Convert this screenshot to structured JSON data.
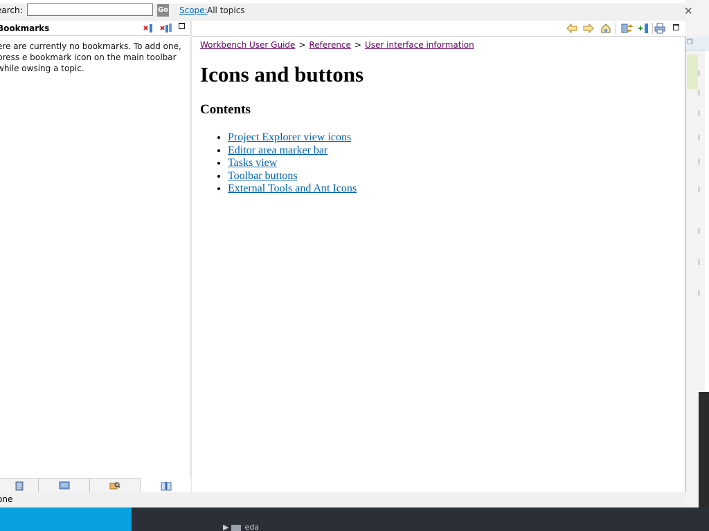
{
  "search": {
    "label": "earch:",
    "value": "",
    "go_label": "Go",
    "scope_label": "Scope:",
    "scope_value": "All topics"
  },
  "bookmarks": {
    "title": "Bookmarks",
    "message": "ere are currently no bookmarks. To add one, press e bookmark icon on the main toolbar while owsing a topic."
  },
  "status": {
    "text": "one"
  },
  "breadcrumb": {
    "items": [
      "Workbench User Guide",
      "Reference",
      "User interface information"
    ],
    "separator": ">"
  },
  "page": {
    "title": "Icons and buttons",
    "contents_heading": "Contents",
    "toc": [
      "Project Explorer view icons",
      "Editor area marker bar",
      "Tasks view",
      "Toolbar buttons",
      "External Tools and Ant Icons"
    ]
  },
  "taskbar": {
    "label": "eda"
  },
  "colors": {
    "link": "#0060b0",
    "visited_link": "#660066",
    "panel_bg": "#f0f0f0",
    "taskbar_accent": "#0aa1e0"
  },
  "icons": {
    "toolbar": [
      "back-icon",
      "forward-icon",
      "home-icon",
      "sync-toc-icon",
      "bookmark-add-icon",
      "print-icon",
      "maximize-icon"
    ],
    "nav_tabs": [
      "contents-icon",
      "index-icon",
      "search-results-icon",
      "bookmarks-icon"
    ]
  }
}
